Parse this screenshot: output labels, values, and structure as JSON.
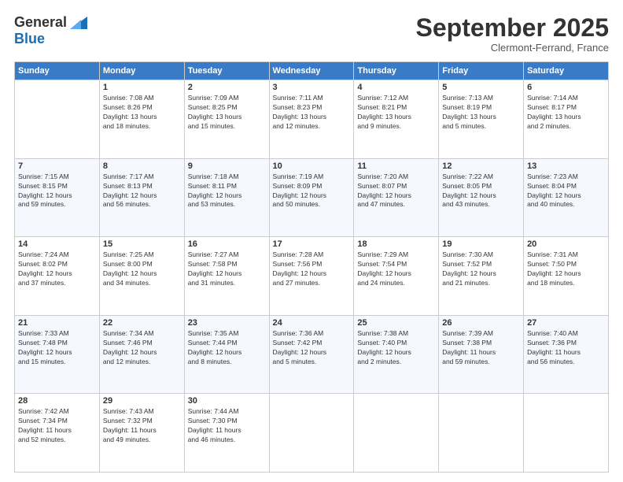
{
  "logo": {
    "general": "General",
    "blue": "Blue"
  },
  "title": "September 2025",
  "subtitle": "Clermont-Ferrand, France",
  "days_of_week": [
    "Sunday",
    "Monday",
    "Tuesday",
    "Wednesday",
    "Thursday",
    "Friday",
    "Saturday"
  ],
  "weeks": [
    [
      {
        "day": "",
        "info": ""
      },
      {
        "day": "1",
        "info": "Sunrise: 7:08 AM\nSunset: 8:26 PM\nDaylight: 13 hours\nand 18 minutes."
      },
      {
        "day": "2",
        "info": "Sunrise: 7:09 AM\nSunset: 8:25 PM\nDaylight: 13 hours\nand 15 minutes."
      },
      {
        "day": "3",
        "info": "Sunrise: 7:11 AM\nSunset: 8:23 PM\nDaylight: 13 hours\nand 12 minutes."
      },
      {
        "day": "4",
        "info": "Sunrise: 7:12 AM\nSunset: 8:21 PM\nDaylight: 13 hours\nand 9 minutes."
      },
      {
        "day": "5",
        "info": "Sunrise: 7:13 AM\nSunset: 8:19 PM\nDaylight: 13 hours\nand 5 minutes."
      },
      {
        "day": "6",
        "info": "Sunrise: 7:14 AM\nSunset: 8:17 PM\nDaylight: 13 hours\nand 2 minutes."
      }
    ],
    [
      {
        "day": "7",
        "info": "Sunrise: 7:15 AM\nSunset: 8:15 PM\nDaylight: 12 hours\nand 59 minutes."
      },
      {
        "day": "8",
        "info": "Sunrise: 7:17 AM\nSunset: 8:13 PM\nDaylight: 12 hours\nand 56 minutes."
      },
      {
        "day": "9",
        "info": "Sunrise: 7:18 AM\nSunset: 8:11 PM\nDaylight: 12 hours\nand 53 minutes."
      },
      {
        "day": "10",
        "info": "Sunrise: 7:19 AM\nSunset: 8:09 PM\nDaylight: 12 hours\nand 50 minutes."
      },
      {
        "day": "11",
        "info": "Sunrise: 7:20 AM\nSunset: 8:07 PM\nDaylight: 12 hours\nand 47 minutes."
      },
      {
        "day": "12",
        "info": "Sunrise: 7:22 AM\nSunset: 8:05 PM\nDaylight: 12 hours\nand 43 minutes."
      },
      {
        "day": "13",
        "info": "Sunrise: 7:23 AM\nSunset: 8:04 PM\nDaylight: 12 hours\nand 40 minutes."
      }
    ],
    [
      {
        "day": "14",
        "info": "Sunrise: 7:24 AM\nSunset: 8:02 PM\nDaylight: 12 hours\nand 37 minutes."
      },
      {
        "day": "15",
        "info": "Sunrise: 7:25 AM\nSunset: 8:00 PM\nDaylight: 12 hours\nand 34 minutes."
      },
      {
        "day": "16",
        "info": "Sunrise: 7:27 AM\nSunset: 7:58 PM\nDaylight: 12 hours\nand 31 minutes."
      },
      {
        "day": "17",
        "info": "Sunrise: 7:28 AM\nSunset: 7:56 PM\nDaylight: 12 hours\nand 27 minutes."
      },
      {
        "day": "18",
        "info": "Sunrise: 7:29 AM\nSunset: 7:54 PM\nDaylight: 12 hours\nand 24 minutes."
      },
      {
        "day": "19",
        "info": "Sunrise: 7:30 AM\nSunset: 7:52 PM\nDaylight: 12 hours\nand 21 minutes."
      },
      {
        "day": "20",
        "info": "Sunrise: 7:31 AM\nSunset: 7:50 PM\nDaylight: 12 hours\nand 18 minutes."
      }
    ],
    [
      {
        "day": "21",
        "info": "Sunrise: 7:33 AM\nSunset: 7:48 PM\nDaylight: 12 hours\nand 15 minutes."
      },
      {
        "day": "22",
        "info": "Sunrise: 7:34 AM\nSunset: 7:46 PM\nDaylight: 12 hours\nand 12 minutes."
      },
      {
        "day": "23",
        "info": "Sunrise: 7:35 AM\nSunset: 7:44 PM\nDaylight: 12 hours\nand 8 minutes."
      },
      {
        "day": "24",
        "info": "Sunrise: 7:36 AM\nSunset: 7:42 PM\nDaylight: 12 hours\nand 5 minutes."
      },
      {
        "day": "25",
        "info": "Sunrise: 7:38 AM\nSunset: 7:40 PM\nDaylight: 12 hours\nand 2 minutes."
      },
      {
        "day": "26",
        "info": "Sunrise: 7:39 AM\nSunset: 7:38 PM\nDaylight: 11 hours\nand 59 minutes."
      },
      {
        "day": "27",
        "info": "Sunrise: 7:40 AM\nSunset: 7:36 PM\nDaylight: 11 hours\nand 56 minutes."
      }
    ],
    [
      {
        "day": "28",
        "info": "Sunrise: 7:42 AM\nSunset: 7:34 PM\nDaylight: 11 hours\nand 52 minutes."
      },
      {
        "day": "29",
        "info": "Sunrise: 7:43 AM\nSunset: 7:32 PM\nDaylight: 11 hours\nand 49 minutes."
      },
      {
        "day": "30",
        "info": "Sunrise: 7:44 AM\nSunset: 7:30 PM\nDaylight: 11 hours\nand 46 minutes."
      },
      {
        "day": "",
        "info": ""
      },
      {
        "day": "",
        "info": ""
      },
      {
        "day": "",
        "info": ""
      },
      {
        "day": "",
        "info": ""
      }
    ]
  ]
}
